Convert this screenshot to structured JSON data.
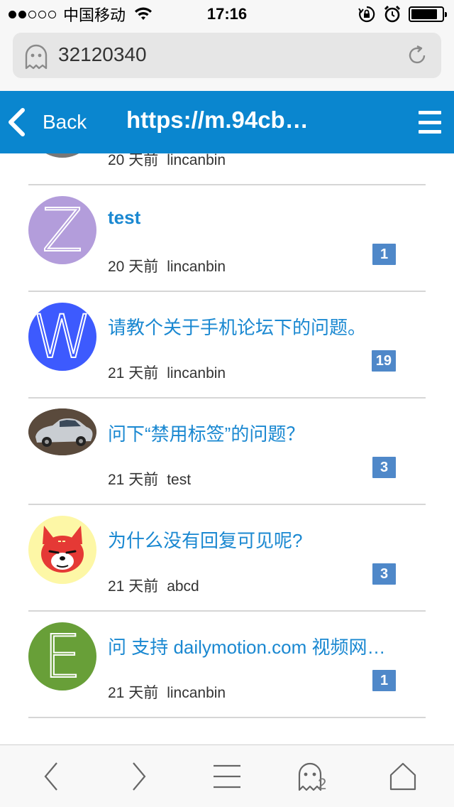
{
  "status_bar": {
    "carrier": "中国移动",
    "time": "17:16",
    "signal_bars_filled": 2,
    "signal_bars_total": 5,
    "battery_level": 0.85
  },
  "address_bar": {
    "text": "32120340",
    "left_icon": "ghost-icon",
    "right_icon": "reload-icon"
  },
  "header": {
    "back_label": "Back",
    "title": "https://m.94cb…",
    "back_icon": "chevron-left-icon",
    "menu_icon": "hamburger-menu-icon",
    "background": "#0a86cf"
  },
  "topics": [
    {
      "title": "",
      "time": "20 天前",
      "author": "lincanbin",
      "replies": "",
      "avatar": "gray-circle",
      "avatar_color": "#777777",
      "title_bold": false
    },
    {
      "title": "test",
      "time": "20 天前",
      "author": "lincanbin",
      "replies": "1",
      "avatar": "Z",
      "avatar_color": "#b39ddb",
      "title_bold": true
    },
    {
      "title": "请教个关于手机论坛下的问题。",
      "time": "21 天前",
      "author": "lincanbin",
      "replies": "19",
      "avatar": "W",
      "avatar_color": "#3d5afe",
      "title_bold": false
    },
    {
      "title": "问下“禁用标签”的问题？",
      "time": "21 天前",
      "author": "test",
      "replies": "3",
      "avatar": "car-photo",
      "avatar_color": "#6b5a4a",
      "title_bold": false
    },
    {
      "title": "为什么没有回复可见呢?",
      "time": "21 天前",
      "author": "abcd",
      "replies": "3",
      "avatar": "fox-cartoon",
      "avatar_color": "#fdf7a6",
      "title_bold": false
    },
    {
      "title": "问 支持 dailymotion.com 视频网…",
      "time": "21 天前",
      "author": "lincanbin",
      "replies": "1",
      "avatar": "E",
      "avatar_color": "#689f38",
      "title_bold": false
    }
  ],
  "toolbar": {
    "back_icon": "chevron-left-icon",
    "forward_icon": "chevron-right-icon",
    "menu_icon": "menu-lines-icon",
    "tabs_icon": "ghost-tabs-icon",
    "tab_count": "2",
    "home_icon": "home-icon"
  },
  "colors": {
    "link": "#1a88d1",
    "badge": "#4f88c9",
    "divider": "#d6d6d6"
  }
}
